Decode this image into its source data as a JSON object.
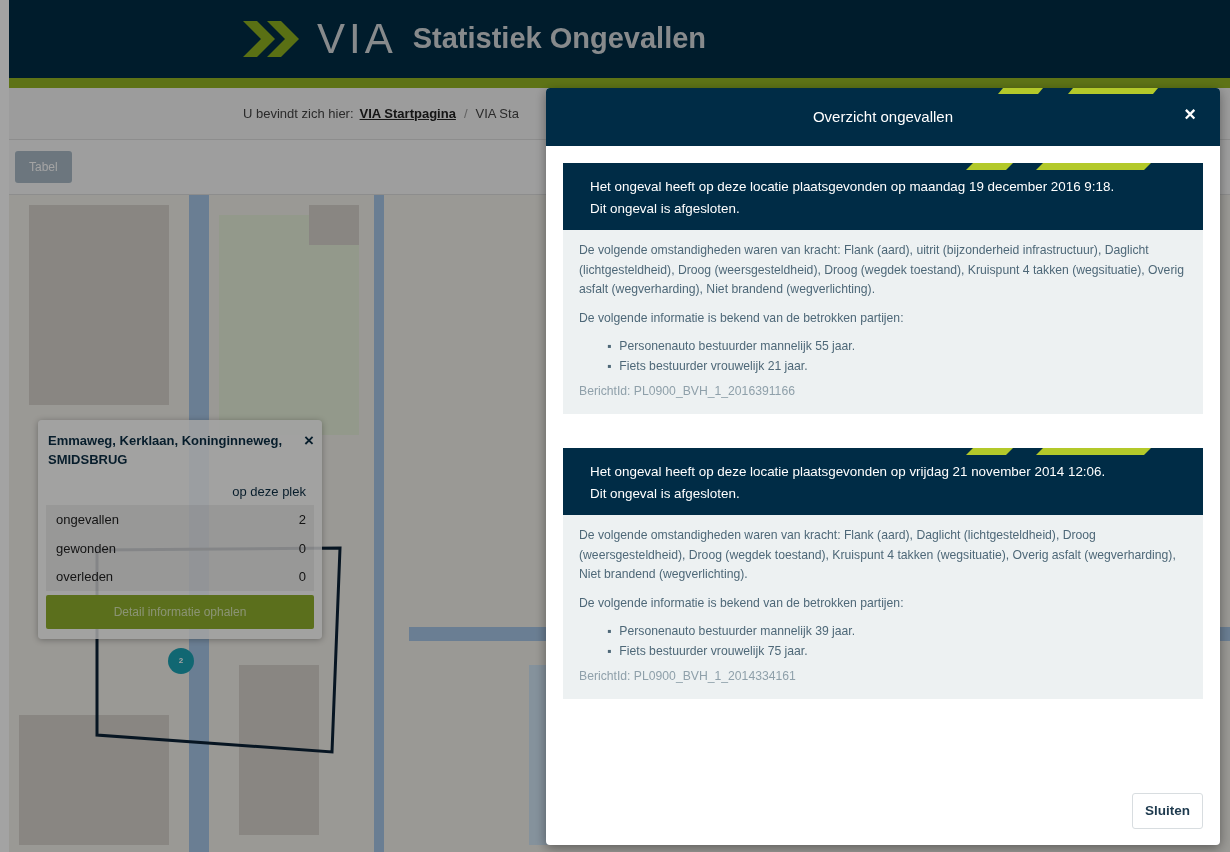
{
  "header": {
    "logo": "VIA",
    "title": "Statistiek Ongevallen"
  },
  "breadcrumb": {
    "label": "U bevindt zich hier:",
    "separator": "/",
    "items": [
      "VIA Startpagina",
      "VIA Sta"
    ]
  },
  "toolbar": {
    "buttons": [
      "Tabel"
    ]
  },
  "map": {
    "kind": "picture",
    "marker": {
      "count": "2"
    },
    "popup": {
      "title": "Emmaweg, Kerklaan, Koninginneweg, SMIDSBRUG",
      "close": "×",
      "column_header": "op deze plek",
      "rows": [
        {
          "label": "ongevallen",
          "value": "2"
        },
        {
          "label": "gewonden",
          "value": "0"
        },
        {
          "label": "overleden",
          "value": "0"
        }
      ],
      "button": "Detail informatie ophalen"
    }
  },
  "modal": {
    "title": "Overzicht ongevallen",
    "close": "×",
    "bullet": "▪",
    "accidents": [
      {
        "summary": "Het ongeval heeft op deze locatie plaatsgevonden op maandag 19 december 2016 9:18.",
        "status": "Dit ongeval is afgesloten.",
        "circumstances": "De volgende omstandigheden waren van kracht: Flank (aard), uitrit (bijzonderheid infrastructuur), Daglicht (lichtgesteldheid), Droog (weersgesteldheid), Droog (wegdek toestand), Kruispunt 4 takken (wegsituatie), Overig asfalt (wegverharding), Niet brandend (wegverlichting).",
        "parties_intro": "De volgende informatie is bekend van de betrokken partijen:",
        "parties": [
          "Personenauto bestuurder mannelijk 55 jaar.",
          "Fiets bestuurder vrouwelijk 21 jaar."
        ],
        "message_id": "BerichtId: PL0900_BVH_1_2016391166"
      },
      {
        "summary": "Het ongeval heeft op deze locatie plaatsgevonden op vrijdag 21 november 2014 12:06.",
        "status": "Dit ongeval is afgesloten.",
        "circumstances": "De volgende omstandigheden waren van kracht: Flank (aard), Daglicht (lichtgesteldheid), Droog (weersgesteldheid), Droog (wegdek toestand), Kruispunt 4 takken (wegsituatie), Overig asfalt (wegverharding), Niet brandend (wegverlichting).",
        "parties_intro": "De volgende informatie is bekend van de betrokken partijen:",
        "parties": [
          "Personenauto bestuurder mannelijk 39 jaar.",
          "Fiets bestuurder vrouwelijk 75 jaar."
        ],
        "message_id": "BerichtId: PL0900_BVH_1_2014334161"
      }
    ],
    "footer_button": "Sluiten"
  }
}
